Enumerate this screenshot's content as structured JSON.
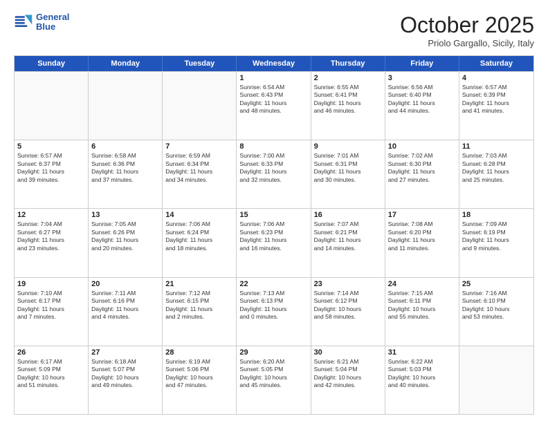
{
  "header": {
    "logo_line1": "General",
    "logo_line2": "Blue",
    "month": "October 2025",
    "location": "Priolo Gargallo, Sicily, Italy"
  },
  "weekdays": [
    "Sunday",
    "Monday",
    "Tuesday",
    "Wednesday",
    "Thursday",
    "Friday",
    "Saturday"
  ],
  "rows": [
    [
      {
        "day": "",
        "info": ""
      },
      {
        "day": "",
        "info": ""
      },
      {
        "day": "",
        "info": ""
      },
      {
        "day": "1",
        "info": "Sunrise: 6:54 AM\nSunset: 6:43 PM\nDaylight: 11 hours\nand 48 minutes."
      },
      {
        "day": "2",
        "info": "Sunrise: 6:55 AM\nSunset: 6:41 PM\nDaylight: 11 hours\nand 46 minutes."
      },
      {
        "day": "3",
        "info": "Sunrise: 6:56 AM\nSunset: 6:40 PM\nDaylight: 11 hours\nand 44 minutes."
      },
      {
        "day": "4",
        "info": "Sunrise: 6:57 AM\nSunset: 6:39 PM\nDaylight: 11 hours\nand 41 minutes."
      }
    ],
    [
      {
        "day": "5",
        "info": "Sunrise: 6:57 AM\nSunset: 6:37 PM\nDaylight: 11 hours\nand 39 minutes."
      },
      {
        "day": "6",
        "info": "Sunrise: 6:58 AM\nSunset: 6:36 PM\nDaylight: 11 hours\nand 37 minutes."
      },
      {
        "day": "7",
        "info": "Sunrise: 6:59 AM\nSunset: 6:34 PM\nDaylight: 11 hours\nand 34 minutes."
      },
      {
        "day": "8",
        "info": "Sunrise: 7:00 AM\nSunset: 6:33 PM\nDaylight: 11 hours\nand 32 minutes."
      },
      {
        "day": "9",
        "info": "Sunrise: 7:01 AM\nSunset: 6:31 PM\nDaylight: 11 hours\nand 30 minutes."
      },
      {
        "day": "10",
        "info": "Sunrise: 7:02 AM\nSunset: 6:30 PM\nDaylight: 11 hours\nand 27 minutes."
      },
      {
        "day": "11",
        "info": "Sunrise: 7:03 AM\nSunset: 6:28 PM\nDaylight: 11 hours\nand 25 minutes."
      }
    ],
    [
      {
        "day": "12",
        "info": "Sunrise: 7:04 AM\nSunset: 6:27 PM\nDaylight: 11 hours\nand 23 minutes."
      },
      {
        "day": "13",
        "info": "Sunrise: 7:05 AM\nSunset: 6:26 PM\nDaylight: 11 hours\nand 20 minutes."
      },
      {
        "day": "14",
        "info": "Sunrise: 7:06 AM\nSunset: 6:24 PM\nDaylight: 11 hours\nand 18 minutes."
      },
      {
        "day": "15",
        "info": "Sunrise: 7:06 AM\nSunset: 6:23 PM\nDaylight: 11 hours\nand 16 minutes."
      },
      {
        "day": "16",
        "info": "Sunrise: 7:07 AM\nSunset: 6:21 PM\nDaylight: 11 hours\nand 14 minutes."
      },
      {
        "day": "17",
        "info": "Sunrise: 7:08 AM\nSunset: 6:20 PM\nDaylight: 11 hours\nand 11 minutes."
      },
      {
        "day": "18",
        "info": "Sunrise: 7:09 AM\nSunset: 6:19 PM\nDaylight: 11 hours\nand 9 minutes."
      }
    ],
    [
      {
        "day": "19",
        "info": "Sunrise: 7:10 AM\nSunset: 6:17 PM\nDaylight: 11 hours\nand 7 minutes."
      },
      {
        "day": "20",
        "info": "Sunrise: 7:11 AM\nSunset: 6:16 PM\nDaylight: 11 hours\nand 4 minutes."
      },
      {
        "day": "21",
        "info": "Sunrise: 7:12 AM\nSunset: 6:15 PM\nDaylight: 11 hours\nand 2 minutes."
      },
      {
        "day": "22",
        "info": "Sunrise: 7:13 AM\nSunset: 6:13 PM\nDaylight: 11 hours\nand 0 minutes."
      },
      {
        "day": "23",
        "info": "Sunrise: 7:14 AM\nSunset: 6:12 PM\nDaylight: 10 hours\nand 58 minutes."
      },
      {
        "day": "24",
        "info": "Sunrise: 7:15 AM\nSunset: 6:11 PM\nDaylight: 10 hours\nand 55 minutes."
      },
      {
        "day": "25",
        "info": "Sunrise: 7:16 AM\nSunset: 6:10 PM\nDaylight: 10 hours\nand 53 minutes."
      }
    ],
    [
      {
        "day": "26",
        "info": "Sunrise: 6:17 AM\nSunset: 5:09 PM\nDaylight: 10 hours\nand 51 minutes."
      },
      {
        "day": "27",
        "info": "Sunrise: 6:18 AM\nSunset: 5:07 PM\nDaylight: 10 hours\nand 49 minutes."
      },
      {
        "day": "28",
        "info": "Sunrise: 6:19 AM\nSunset: 5:06 PM\nDaylight: 10 hours\nand 47 minutes."
      },
      {
        "day": "29",
        "info": "Sunrise: 6:20 AM\nSunset: 5:05 PM\nDaylight: 10 hours\nand 45 minutes."
      },
      {
        "day": "30",
        "info": "Sunrise: 6:21 AM\nSunset: 5:04 PM\nDaylight: 10 hours\nand 42 minutes."
      },
      {
        "day": "31",
        "info": "Sunrise: 6:22 AM\nSunset: 5:03 PM\nDaylight: 10 hours\nand 40 minutes."
      },
      {
        "day": "",
        "info": ""
      }
    ]
  ]
}
